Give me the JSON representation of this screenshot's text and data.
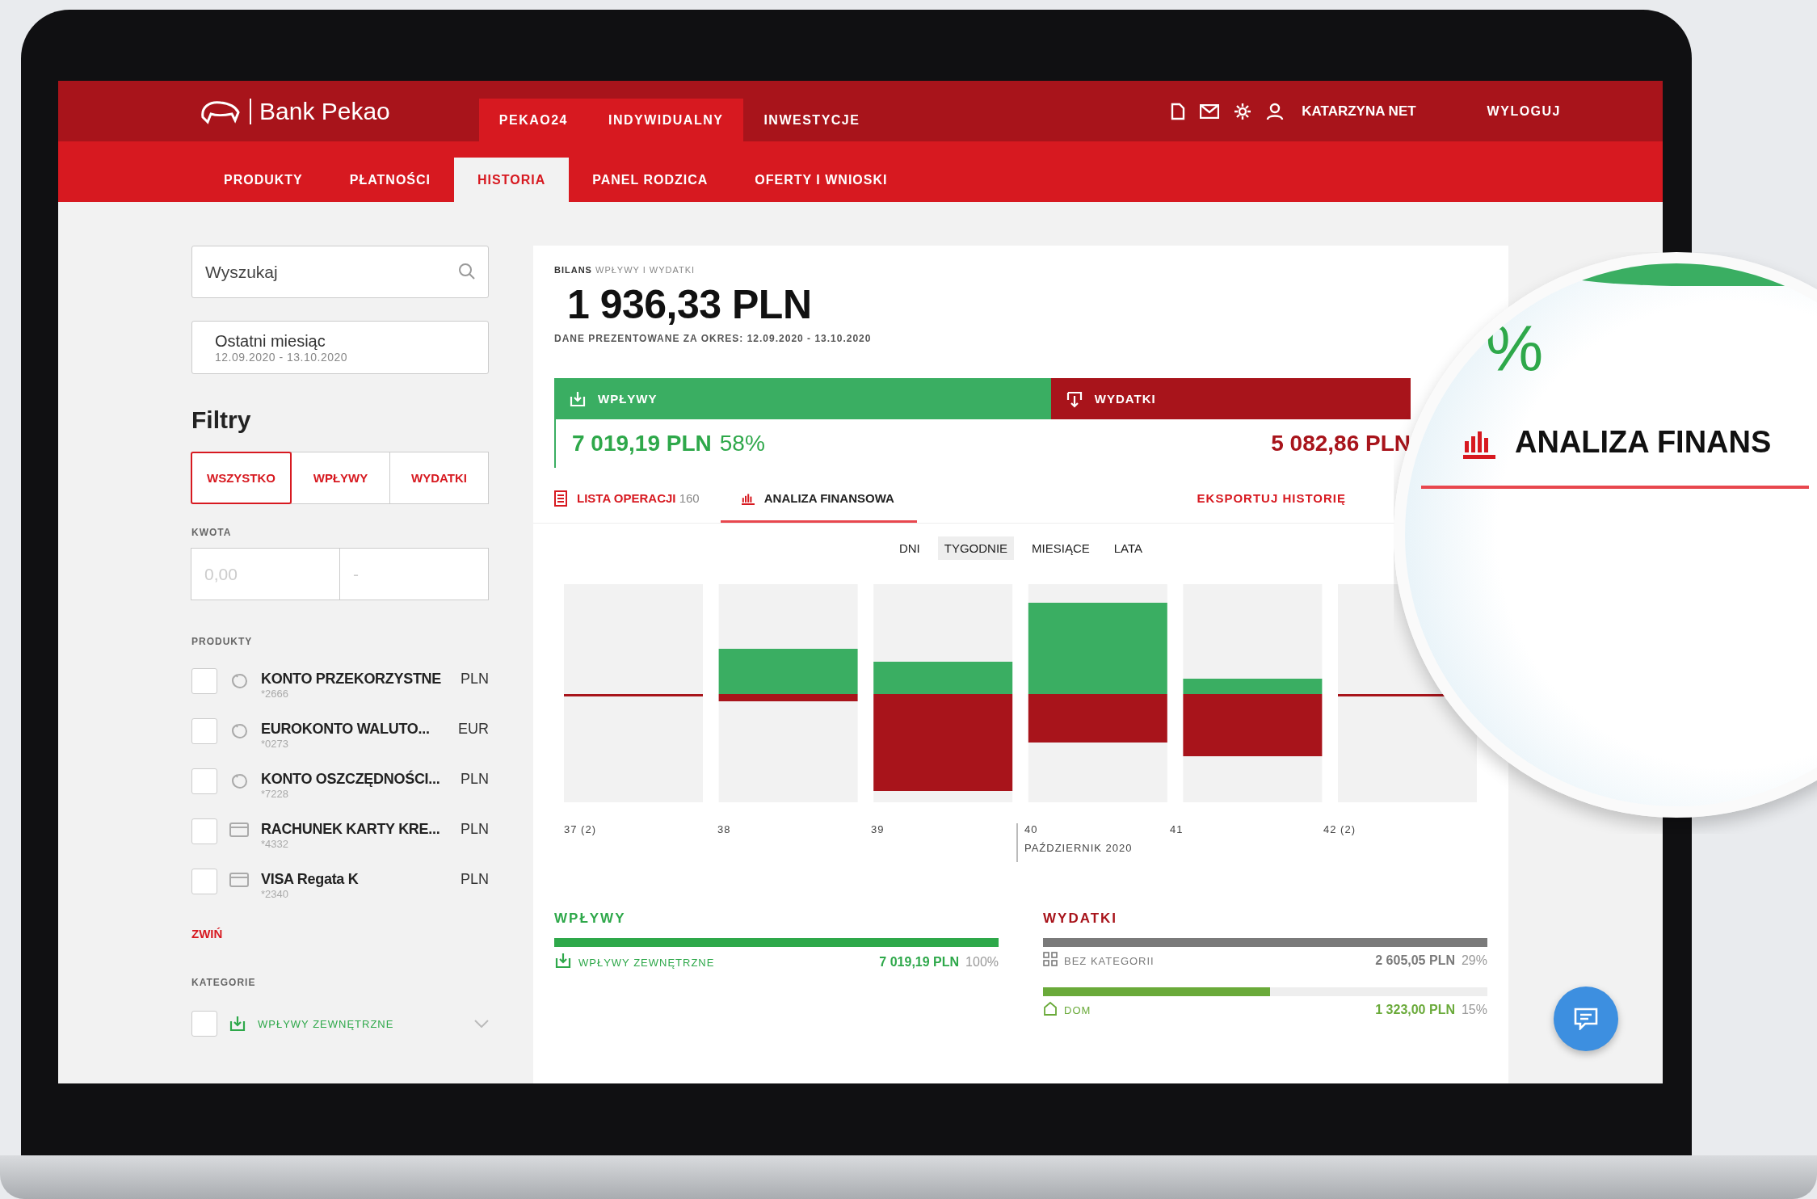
{
  "header": {
    "logo": "Bank Pekao",
    "top_tabs": [
      {
        "label": "PEKAO24",
        "selected": true
      },
      {
        "label": "INDYWIDUALNY",
        "selected": true
      },
      {
        "label": "INWESTYCJE",
        "selected": false
      }
    ],
    "user": "KATARZYNA NET",
    "logout": "WYLOGUJ",
    "nav": [
      {
        "label": "PRODUKTY",
        "selected": false
      },
      {
        "label": "PŁATNOŚCI",
        "selected": false
      },
      {
        "label": "HISTORIA",
        "selected": true
      },
      {
        "label": "PANEL RODZICA",
        "selected": false
      },
      {
        "label": "OFERTY I WNIOSKI",
        "selected": false
      }
    ]
  },
  "sidebar": {
    "search": {
      "placeholder": "Wyszukaj"
    },
    "period": {
      "label": "Ostatni miesiąc",
      "range": "12.09.2020 - 13.10.2020"
    },
    "filters_title": "Filtry",
    "filter_tabs": [
      {
        "label": "WSZYSTKO",
        "selected": true
      },
      {
        "label": "WPŁYWY",
        "selected": false
      },
      {
        "label": "WYDATKI",
        "selected": false
      }
    ],
    "amount": {
      "label": "KWOTA",
      "from_placeholder": "0,00",
      "to_placeholder": "-"
    },
    "products_label": "PRODUKTY",
    "products": [
      {
        "name": "KONTO PRZEKORZYSTNE",
        "currency": "PLN",
        "number": "*2666",
        "kind": "savings",
        "checked": false
      },
      {
        "name": "EUROKONTO WALUTO...",
        "currency": "EUR",
        "number": "*0273",
        "kind": "savings",
        "checked": false
      },
      {
        "name": "KONTO OSZCZĘDNOŚCI...",
        "currency": "PLN",
        "number": "*7228",
        "kind": "savings",
        "checked": false
      },
      {
        "name": "RACHUNEK KARTY KRE...",
        "currency": "PLN",
        "number": "*4332",
        "kind": "card",
        "checked": false
      },
      {
        "name": "VISA Regata K",
        "currency": "PLN",
        "number": "*2340",
        "kind": "card",
        "checked": false
      }
    ],
    "collapse": "ZWIŃ",
    "categories_label": "KATEGORIE",
    "categories": [
      {
        "name": "WPŁYWY ZEWNĘTRZNE",
        "checked": false,
        "expanded": false
      }
    ]
  },
  "summary": {
    "caption": "**BILANS** WPŁYWY I WYDATKI",
    "balance": "1 936,33 PLN",
    "period_note": "DANE PREZENTOWANE ZA OKRES: 12.09.2020 - 13.10.2020",
    "income": {
      "label": "WPŁYWY",
      "amount": "7 019,19 PLN",
      "share": "58%",
      "level": 0.58
    },
    "expenses": {
      "label": "WYDATKI",
      "amount": "5 082,86 PLN"
    }
  },
  "tabs": [
    {
      "label": "LISTA OPERACJI",
      "count": "160",
      "selected": false
    },
    {
      "label": "ANALIZA FINANSOWA",
      "selected": true
    }
  ],
  "export": "EKSPORTUJ HISTORIĘ",
  "periods": [
    {
      "label": "DNI",
      "selected": false
    },
    {
      "label": "TYGODNIE",
      "selected": true
    },
    {
      "label": "MIESIĄCE",
      "selected": false
    },
    {
      "label": "LATA",
      "selected": false
    }
  ],
  "chart": {
    "week_labels": [
      "37 (2)",
      "38",
      "39",
      "40",
      "41",
      "42 (2)"
    ],
    "month_label": "PAŹDZIERNIK 2020"
  },
  "breakdown": {
    "income": {
      "title": "WPŁYWY",
      "items": [
        {
          "name": "WPŁYWY ZEWNĘTRZNE",
          "kind": "income",
          "amount": "7 019,19 PLN",
          "share": "100%",
          "level": 1,
          "color": "#2ea84a"
        }
      ]
    },
    "expenses": {
      "title": "WYDATKI",
      "items": [
        {
          "name": "BEZ KATEGORII",
          "kind": "uncategorized",
          "amount": "2 605,05 PLN",
          "share": "29%",
          "level": 1,
          "color": "#7a7a7a"
        },
        {
          "name": "DOM",
          "kind": "home",
          "amount": "1 323,00 PLN",
          "share": "15%",
          "level": 0.51,
          "color": "#6aaa3a"
        }
      ]
    }
  },
  "magnifier": {
    "share_fragment": "%",
    "tab_fragment": "ANALIZA FINANS"
  }
}
